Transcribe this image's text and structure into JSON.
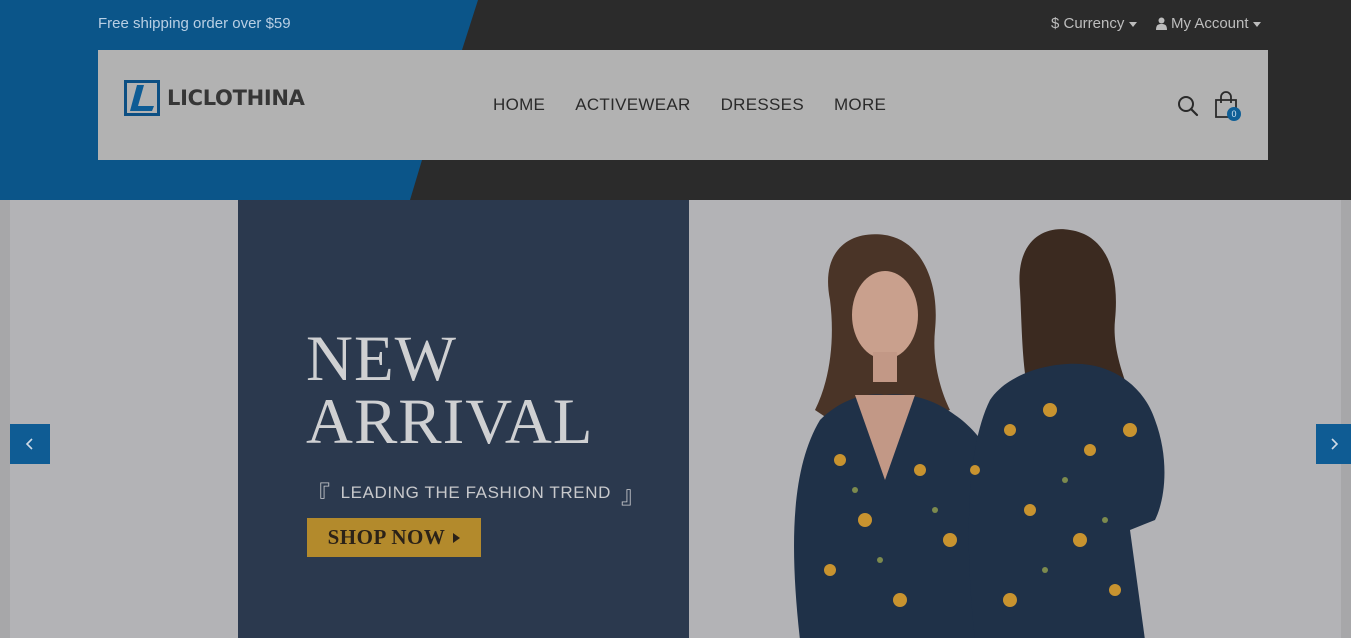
{
  "topbar": {
    "shipping_text": "Free shipping order over $59",
    "currency_label": "$ Currency",
    "account_label": "My Account"
  },
  "header": {
    "logo_text": "LICLOTHINA",
    "menu": [
      {
        "label": "HOME"
      },
      {
        "label": "ACTIVEWEAR"
      },
      {
        "label": "DRESSES"
      },
      {
        "label": "MORE"
      }
    ],
    "cart_count": "0"
  },
  "hero": {
    "headline_line1": "NEW",
    "headline_line2": "ARRIVAL",
    "tagline": "LEADING THE FASHION TREND",
    "bracket_open": "『",
    "bracket_close": "』",
    "cta_label": "SHOP NOW"
  },
  "colors": {
    "brand_blue": "#0f5c94",
    "cta_gold": "#b38a2c",
    "panel_navy": "#2b394e"
  },
  "icons": [
    "logo-mark-icon",
    "user-icon",
    "search-icon",
    "shopping-bag-icon",
    "chevron-left-icon",
    "chevron-right-icon"
  ]
}
